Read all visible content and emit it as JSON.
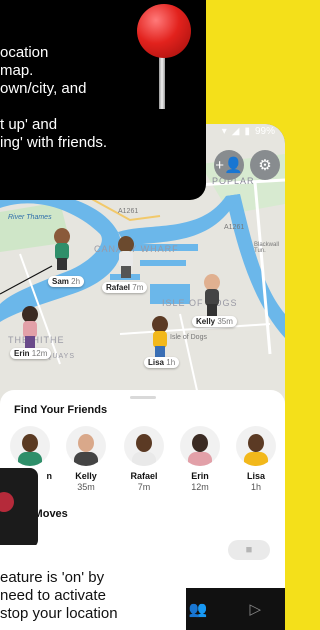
{
  "callout_top": {
    "lines": [
      "ocation",
      "map.",
      "own/city, and",
      "",
      "t up' and",
      "ing' with friends."
    ]
  },
  "callout_bottom": {
    "lines": [
      "eature is 'on' by",
      "need to activate",
      "stop your location"
    ]
  },
  "status_bar": {
    "battery": "99%"
  },
  "map": {
    "labels": {
      "river": "River Thames",
      "canary": "CANARY WHARF",
      "poplar": "POPLAR",
      "isle": "ISLE OF DOGS",
      "isle_small": "Isle of Dogs",
      "hithe": "THE HITHE",
      "quays": "QUAYS",
      "a1261": "A1261",
      "a1261b": "A1261",
      "blackwall": "Blackwall Tun."
    },
    "pins": [
      {
        "name": "Sam",
        "time": "2h"
      },
      {
        "name": "Rafael",
        "time": "7m"
      },
      {
        "name": "Kelly",
        "time": "35m"
      },
      {
        "name": "Lisa",
        "time": "1h"
      },
      {
        "name": "Erin",
        "time": "12m"
      }
    ],
    "buttons": {
      "add_friend": "+👤",
      "settings": "⚙"
    }
  },
  "drawer": {
    "find_title": "Find Your Friends",
    "friends": [
      {
        "name": "n",
        "time": ""
      },
      {
        "name": "Kelly",
        "time": "35m"
      },
      {
        "name": "Rafael",
        "time": "7m"
      },
      {
        "name": "Erin",
        "time": "12m"
      },
      {
        "name": "Lisa",
        "time": "1h"
      }
    ],
    "recent_title": "ent Moves"
  },
  "nav": {
    "friends_icon": "👥",
    "play_icon": "▷"
  },
  "colors": {
    "background": "#f4e01a",
    "water": "#6bb7ea",
    "pin_red": "#e2221d"
  }
}
